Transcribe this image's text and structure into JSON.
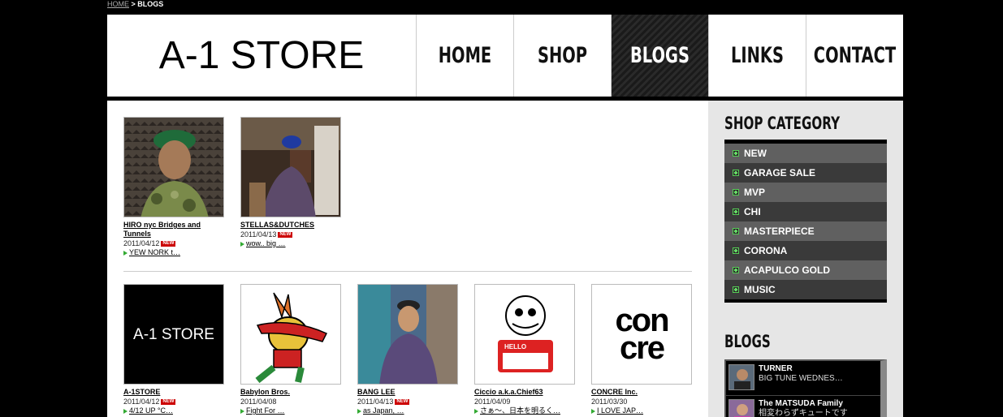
{
  "breadcrumb": {
    "home": "HOME",
    "sep": ">",
    "current": "BLOGS"
  },
  "header": {
    "logo": "A-1 STORE",
    "nav": [
      {
        "label": "HOME",
        "active": false
      },
      {
        "label": "SHOP",
        "active": false
      },
      {
        "label": "BLOGS",
        "active": true
      },
      {
        "label": "LINKS",
        "active": false
      },
      {
        "label": "CONTACT",
        "active": false
      }
    ]
  },
  "main": {
    "row1": [
      {
        "title": "HIRO nyc Bridges and Tunnels",
        "date": "2011/04/12",
        "new": "NEW",
        "excerpt": "YEW NORK t…"
      },
      {
        "title": "STELLAS&DUTCHES",
        "date": "2011/04/13",
        "new": "NEW",
        "excerpt": "wow.. big …"
      }
    ],
    "row2": [
      {
        "title": "A-1STORE",
        "date": "2011/04/12",
        "new": "NEW",
        "excerpt": "4/12 UP °C…",
        "thumb_text": "A-1 STORE"
      },
      {
        "title": "Babylon Bros.",
        "date": "2011/04/08",
        "new": "",
        "excerpt": "Fight For …"
      },
      {
        "title": "BANG LEE",
        "date": "2011/04/13",
        "new": "NEW",
        "excerpt": "as Japan, …"
      },
      {
        "title": "Ciccio a.k.a.Chief63",
        "date": "2011/04/09",
        "new": "",
        "excerpt": "さぁ〜、日本を明るく…",
        "thumb_text": "HELLO"
      },
      {
        "title": "CONCRE Inc.",
        "date": "2011/03/30",
        "new": "",
        "excerpt": "I LOVE JAP…",
        "thumb_text_1": "con",
        "thumb_text_2": "cre"
      }
    ]
  },
  "sidebar": {
    "category_heading": "SHOP CATEGORY",
    "categories": [
      "NEW",
      "GARAGE SALE",
      "MVP",
      "CHI",
      "MASTERPIECE",
      "CORONA",
      "ACAPULCO GOLD",
      "MUSIC"
    ],
    "blogs_heading": "BLOGS",
    "blogs": [
      {
        "name": "TURNER",
        "excerpt": "BIG TUNE WEDNES…"
      },
      {
        "name": "The MATSUDA Family",
        "excerpt": "相変わらずキュートです"
      }
    ]
  },
  "colors": {
    "background": "#000000",
    "panel": "#ffffff",
    "sidebar": "#e6e6e6",
    "new_badge": "#cc0000",
    "accent_green": "#33aa33"
  }
}
